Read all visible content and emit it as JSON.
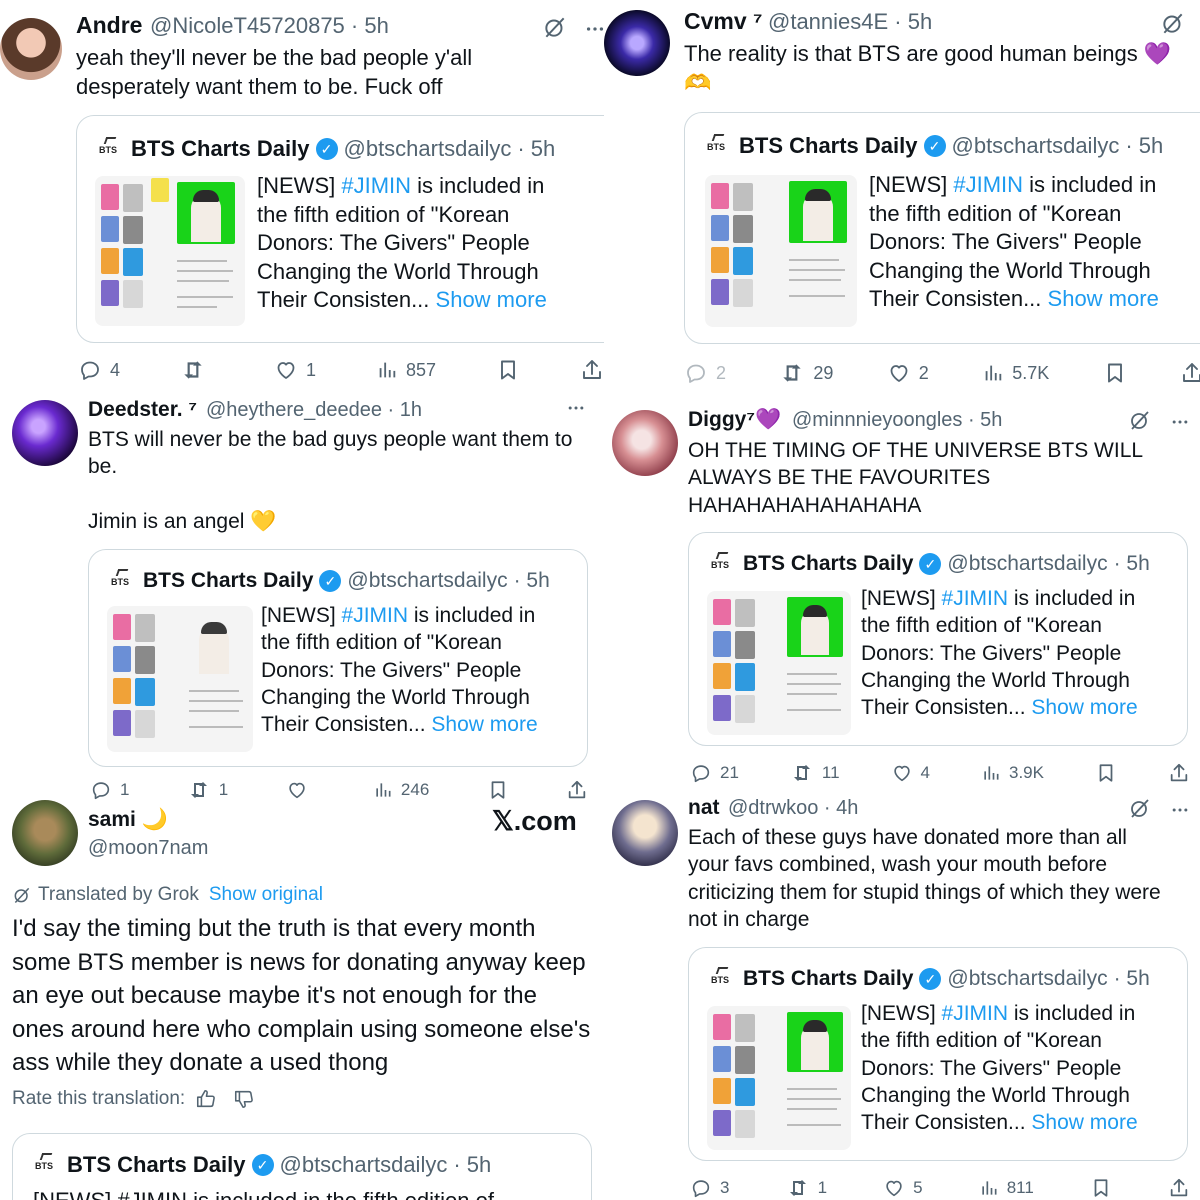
{
  "quote": {
    "name": "BTS Charts Daily",
    "handle": "@btschartsdailyc",
    "time": "· 5h",
    "text_pre": "[NEWS] ",
    "hashtag": "#JIMIN",
    "text_post": " is included in the fifth edition of \"Korean Donors: The Givers\" People Changing the World Through Their Consisten...",
    "show_more": "Show more",
    "truncated_line": "[NEWS] #JIMIN is included in the fifth edition of"
  },
  "tweets": [
    {
      "name": "Andre",
      "handle": "@NicoleT45720875 · 5h",
      "text": "yeah they'll never be the bad people y'all desperately want them to be. Fuck off",
      "replies": "4",
      "retweets": "",
      "likes": "1",
      "views": "857"
    },
    {
      "name": "Cvmv ⁷",
      "handle": "@tannies4E · 5h",
      "text": "The reality is that BTS are good human beings 💜\n🫶",
      "replies": "2",
      "retweets": "29",
      "likes": "2",
      "views": "5.7K"
    },
    {
      "name": "Deedster. ⁷",
      "handle": "@heythere_deedee · 1h",
      "text": "BTS will never be the bad guys people want them to be.\n\nJimin is an angel 💛",
      "replies": "1",
      "retweets": "1",
      "likes": "",
      "views": "246"
    },
    {
      "name": "Diggy⁷💜",
      "handle": "@minnnieyoongles · 5h",
      "text": "OH THE TIMING OF THE UNIVERSE BTS WILL ALWAYS BE THE FAVOURITES HAHAHAHAHAHAHAHA",
      "replies": "21",
      "retweets": "11",
      "likes": "4",
      "views": "3.9K"
    },
    {
      "name": "sami 🌙",
      "handle": "@moon7nam",
      "watermark": "𝕏.com",
      "translated_label": "Translated by Grok",
      "show_original": "Show original",
      "text": "I'd say the timing but the truth is that every month some BTS member is news for donating anyway keep an eye out because maybe it's not enough for the ones around here who complain using someone else's ass while they donate a used thong",
      "rate_label": "Rate this translation:"
    },
    {
      "name": "nat",
      "handle": "@dtrwkoo · 4h",
      "text": "Each of these guys have donated more than all your favs combined, wash your mouth before criticizing them for stupid things of which they were not in charge",
      "replies": "3",
      "retweets": "1",
      "likes": "5",
      "views": "811"
    }
  ],
  "icons": [
    "reply-icon",
    "retweet-icon",
    "like-icon",
    "views-icon",
    "bookmark-icon",
    "share-icon",
    "grok-icon",
    "more-icon",
    "verified-badge-icon",
    "thumbs-up-icon",
    "thumbs-down-icon"
  ],
  "colors": {
    "link": "#1d9bf0",
    "muted": "#536471",
    "border": "#cfd9de",
    "verified": "#1d9bf0"
  }
}
